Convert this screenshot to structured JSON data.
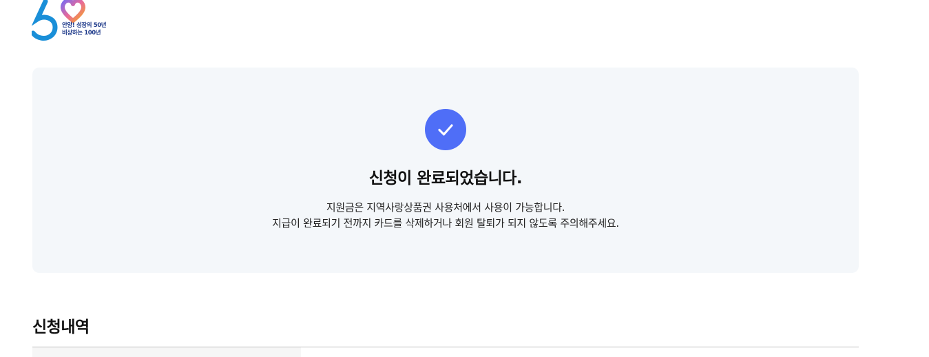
{
  "logo": {
    "line1": "안양! 성장의 50년",
    "line2": "비상하는 100년"
  },
  "result": {
    "title": "신청이 완료되었습니다.",
    "desc_line1": "지원금은 지역사랑상품권 사용처에서 사용이 가능합니다.",
    "desc_line2": "지급이 완료되기 전까지 카드를 삭제하거나 회원 탈퇴가 되지 않도록 주의해주세요."
  },
  "history": {
    "title": "신청내역"
  },
  "colors": {
    "accent": "#4f6ef7",
    "card_bg": "#f4f7fa",
    "logo_blue": "#1a8fd8"
  }
}
